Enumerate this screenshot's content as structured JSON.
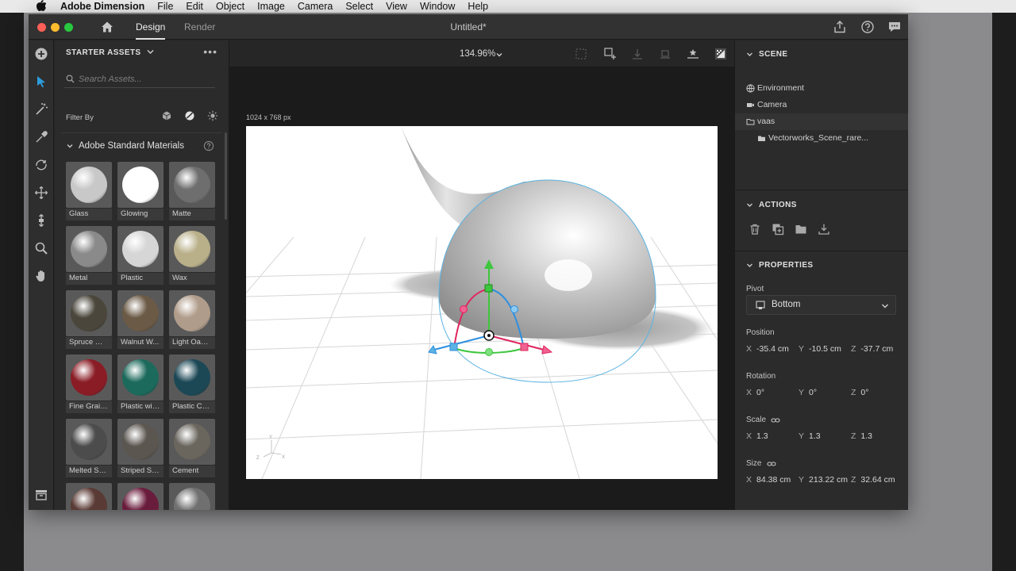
{
  "menubar": {
    "apple": "",
    "app_name": "Adobe Dimension",
    "items": [
      "File",
      "Edit",
      "Object",
      "Image",
      "Camera",
      "Select",
      "View",
      "Window",
      "Help"
    ]
  },
  "titlebar": {
    "tabs": [
      "Design",
      "Render"
    ],
    "active_tab": "Design",
    "document_title": "Untitled*"
  },
  "assets": {
    "header": "STARTER ASSETS",
    "search_placeholder": "Search Assets...",
    "filter_label": "Filter By",
    "section_title": "Adobe Standard Materials",
    "materials": [
      {
        "label": "Glass",
        "color": "#c8c8c8"
      },
      {
        "label": "Glowing",
        "color": "#ffffff"
      },
      {
        "label": "Matte",
        "color": "#6e6e6e"
      },
      {
        "label": "Metal",
        "color": "#8a8a8a"
      },
      {
        "label": "Plastic",
        "color": "#d6d6d6"
      },
      {
        "label": "Wax",
        "color": "#b9b08a"
      },
      {
        "label": "Spruce Wo...",
        "color": "#4a463b"
      },
      {
        "label": "Walnut W...",
        "color": "#6b5a45"
      },
      {
        "label": "Light Oak ...",
        "color": "#b09c8a"
      },
      {
        "label": "Fine Grain...",
        "color": "#8a1c25"
      },
      {
        "label": "Plastic wit...",
        "color": "#1c6a5c"
      },
      {
        "label": "Plastic Can...",
        "color": "#1c4856"
      },
      {
        "label": "Melted Sn...",
        "color": "#4c4c4c"
      },
      {
        "label": "Striped Sto...",
        "color": "#5c5650"
      },
      {
        "label": "Cement",
        "color": "#6a665e"
      },
      {
        "label": "",
        "color": "#5a3a34"
      },
      {
        "label": "",
        "color": "#6a1c3c"
      },
      {
        "label": "",
        "color": "#707070"
      }
    ]
  },
  "viewport": {
    "zoom": "134.96%",
    "canvas_size": "1024 x 768 px",
    "axis_labels": {
      "y": "Y",
      "x": "X",
      "z": "Z"
    }
  },
  "scene": {
    "title": "SCENE",
    "items": [
      {
        "label": "Environment",
        "icon": "globe-icon"
      },
      {
        "label": "Camera",
        "icon": "camera-icon"
      },
      {
        "label": "vaas",
        "icon": "folder-icon"
      },
      {
        "label": "Vectorworks_Scene_rare...",
        "icon": "folder-icon"
      }
    ]
  },
  "actions": {
    "title": "ACTIONS",
    "icons": [
      "trash-icon",
      "duplicate-icon",
      "group-folder-icon",
      "download-icon"
    ]
  },
  "properties": {
    "title": "PROPERTIES",
    "pivot_label": "Pivot",
    "pivot_value": "Bottom",
    "position_label": "Position",
    "position": {
      "x": "-35.4 cm",
      "y": "-10.5 cm",
      "z": "-37.7 cm"
    },
    "rotation_label": "Rotation",
    "rotation": {
      "x": "0°",
      "y": "0°",
      "z": "0°"
    },
    "scale_label": "Scale",
    "scale": {
      "x": "1.3",
      "y": "1.3",
      "z": "1.3"
    },
    "size_label": "Size",
    "size": {
      "x": "84.38 cm",
      "y": "213.22 cm",
      "z": "32.64 cm"
    },
    "axis_letters": {
      "x": "X",
      "y": "Y",
      "z": "Z"
    }
  },
  "colors": {
    "accent": "#2d9cdb",
    "gizmo_red": "#e0245e",
    "gizmo_green": "#3ec63e",
    "gizmo_blue": "#2d8fe0"
  }
}
